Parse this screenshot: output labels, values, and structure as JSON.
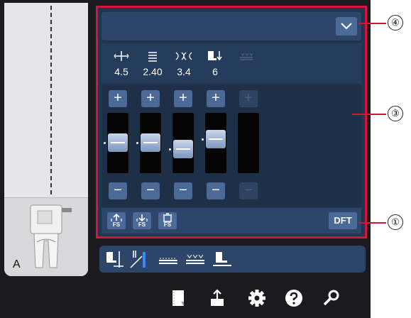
{
  "left_panel": {
    "foot_letter": "A"
  },
  "params": [
    {
      "icon": "stitch-width-icon",
      "value": "4.5"
    },
    {
      "icon": "stitch-length-icon",
      "value": "2.40"
    },
    {
      "icon": "thread-tension-icon",
      "value": "3.4"
    },
    {
      "icon": "foot-pressure-icon",
      "value": "6"
    },
    {
      "icon": "feed-balance-icon",
      "value": ""
    }
  ],
  "sliders": [
    {
      "plus": "+",
      "minus": "−",
      "level": 0.5
    },
    {
      "plus": "+",
      "minus": "−",
      "level": 0.5
    },
    {
      "plus": "+",
      "minus": "−",
      "level": 0.4
    },
    {
      "plus": "+",
      "minus": "−",
      "level": 0.55
    },
    {
      "plus": "+",
      "minus": "−",
      "level": null
    }
  ],
  "bottom_bar": {
    "fs_buttons": [
      "FS",
      "FS",
      "FS"
    ],
    "dft_label": "DFT"
  },
  "callouts": [
    "④",
    "③",
    "①"
  ],
  "colors": {
    "highlight": "#d4143c",
    "panel": "#22354f",
    "button": "#4b6a98"
  }
}
